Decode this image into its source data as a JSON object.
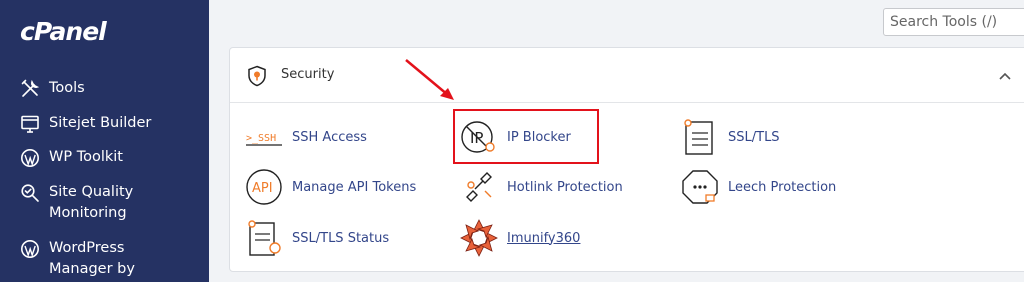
{
  "sidebar": {
    "logo": "cPanel",
    "items": [
      {
        "label": "Tools"
      },
      {
        "label": "Sitejet Builder"
      },
      {
        "label": "WP Toolkit"
      },
      {
        "label_line1": "Site Quality",
        "label_line2": "Monitoring"
      },
      {
        "label_line1": "WordPress",
        "label_line2": "Manager by"
      }
    ]
  },
  "search": {
    "placeholder": "Search Tools (/)"
  },
  "security": {
    "title": "Security",
    "tools": [
      {
        "label": "SSH Access",
        "icon": "ssh-icon"
      },
      {
        "label": "IP Blocker",
        "icon": "ip-blocker-icon"
      },
      {
        "label": "SSL/TLS",
        "icon": "ssl-certificate-icon"
      },
      {
        "label": "Manage API Tokens",
        "icon": "api-icon"
      },
      {
        "label": "Hotlink Protection",
        "icon": "broken-link-icon"
      },
      {
        "label": "Leech Protection",
        "icon": "leech-icon"
      },
      {
        "label": "SSL/TLS Status",
        "icon": "ssl-status-icon"
      },
      {
        "label": "Imunify360",
        "icon": "imunify-icon"
      }
    ],
    "ssh_icon_text": ">_SSH",
    "api_icon_text": "API",
    "ip_icon_text": "IP"
  },
  "colors": {
    "sidebar_bg": "#253263",
    "accent_orange": "#f07c2a",
    "link_blue": "#33468a",
    "highlight_red": "#e3121b"
  }
}
